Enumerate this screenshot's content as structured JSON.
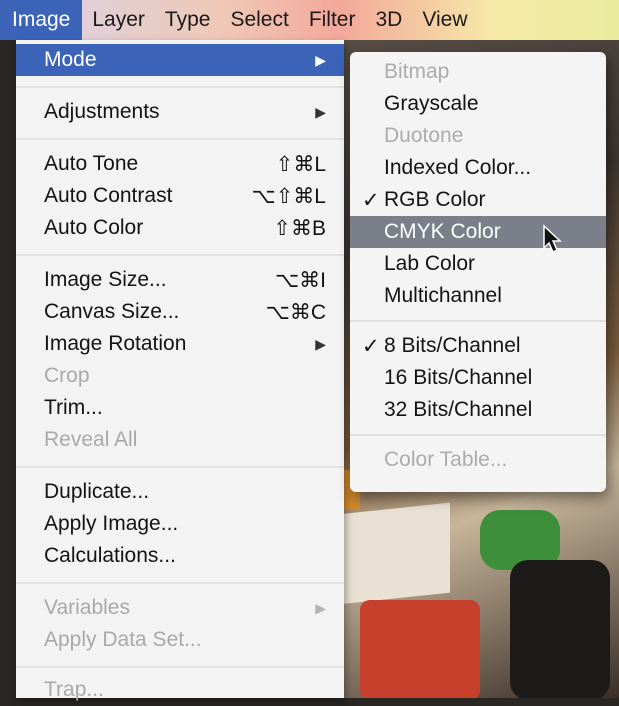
{
  "menubar": {
    "items": [
      {
        "label": "Image",
        "active": true
      },
      {
        "label": "Layer"
      },
      {
        "label": "Type"
      },
      {
        "label": "Select"
      },
      {
        "label": "Filter"
      },
      {
        "label": "3D"
      },
      {
        "label": "View"
      }
    ]
  },
  "image_menu": {
    "items": [
      {
        "label": "Mode",
        "arrow": "▶",
        "highlight": true
      },
      {
        "label": "Adjustments",
        "arrow": "▶"
      },
      {
        "label": "Auto Tone",
        "shortcut": "⇧⌘L"
      },
      {
        "label": "Auto Contrast",
        "shortcut": "⌥⇧⌘L"
      },
      {
        "label": "Auto Color",
        "shortcut": "⇧⌘B"
      },
      {
        "label": "Image Size...",
        "shortcut": "⌥⌘I"
      },
      {
        "label": "Canvas Size...",
        "shortcut": "⌥⌘C"
      },
      {
        "label": "Image Rotation",
        "arrow": "▶"
      },
      {
        "label": "Crop",
        "disabled": true
      },
      {
        "label": "Trim..."
      },
      {
        "label": "Reveal All",
        "disabled": true
      },
      {
        "label": "Duplicate..."
      },
      {
        "label": "Apply Image..."
      },
      {
        "label": "Calculations..."
      },
      {
        "label": "Variables",
        "arrow": "▶",
        "disabled": true
      },
      {
        "label": "Apply Data Set...",
        "disabled": true
      },
      {
        "label": "Trap...",
        "disabled": true
      }
    ]
  },
  "mode_submenu": {
    "check_glyph": "✓",
    "items": [
      {
        "label": "Bitmap",
        "disabled": true
      },
      {
        "label": "Grayscale"
      },
      {
        "label": "Duotone",
        "disabled": true
      },
      {
        "label": "Indexed Color..."
      },
      {
        "label": "RGB Color",
        "checked": true
      },
      {
        "label": "CMYK Color",
        "highlight": true
      },
      {
        "label": "Lab Color"
      },
      {
        "label": "Multichannel"
      },
      {
        "label": "8 Bits/Channel",
        "checked": true
      },
      {
        "label": "16 Bits/Channel"
      },
      {
        "label": "32 Bits/Channel"
      },
      {
        "label": "Color Table...",
        "disabled": true
      }
    ]
  },
  "colors": {
    "menu_highlight": "#3b63b8",
    "submenu_highlight": "#7a7f8a",
    "disabled_text": "#a9a9a9"
  }
}
